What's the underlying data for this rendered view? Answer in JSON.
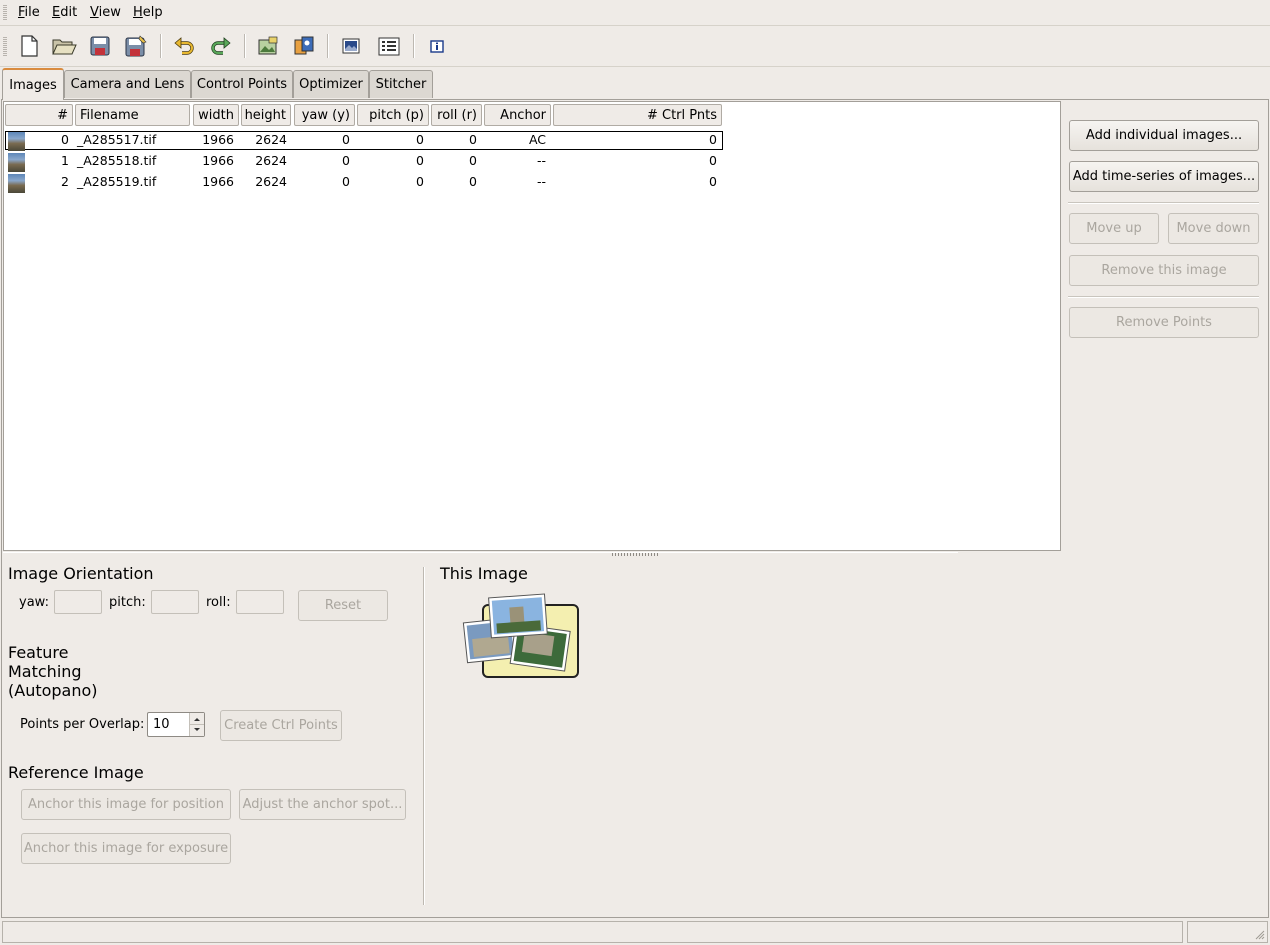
{
  "menu": [
    {
      "label": "File",
      "underline": "F",
      "rest": "ile"
    },
    {
      "label": "Edit",
      "underline": "E",
      "rest": "dit"
    },
    {
      "label": "View",
      "underline": "V",
      "rest": "iew"
    },
    {
      "label": "Help",
      "underline": "H",
      "rest": "elp"
    }
  ],
  "toolbar_icons": [
    "new-file-icon",
    "open-folder-icon",
    "save-icon",
    "save-as-icon",
    "undo-icon",
    "redo-icon",
    "add-images-icon",
    "align-icon",
    "preview-icon",
    "optimizer-list-icon",
    "info-icon"
  ],
  "tabs": [
    "Images",
    "Camera and Lens",
    "Control Points",
    "Optimizer",
    "Stitcher"
  ],
  "columns": [
    "#",
    "Filename",
    "width",
    "height",
    "yaw (y)",
    "pitch (p)",
    "roll (r)",
    "Anchor",
    "# Ctrl Pnts"
  ],
  "rows": [
    {
      "num": "0",
      "filename": "_A285517.tif",
      "width": "1966",
      "height": "2624",
      "yaw": "0",
      "pitch": "0",
      "roll": "0",
      "anchor": "AC",
      "ctrl": "0"
    },
    {
      "num": "1",
      "filename": "_A285518.tif",
      "width": "1966",
      "height": "2624",
      "yaw": "0",
      "pitch": "0",
      "roll": "0",
      "anchor": "--",
      "ctrl": "0"
    },
    {
      "num": "2",
      "filename": "_A285519.tif",
      "width": "1966",
      "height": "2624",
      "yaw": "0",
      "pitch": "0",
      "roll": "0",
      "anchor": "--",
      "ctrl": "0"
    }
  ],
  "side_buttons": {
    "add_individual": "Add individual images...",
    "add_time_series": "Add time-series of images...",
    "move_up": "Move up",
    "move_down": "Move down",
    "remove_image": "Remove this image",
    "remove_points": "Remove Points"
  },
  "orientation": {
    "title": "Image Orientation",
    "yaw_label": "yaw:",
    "pitch_label": "pitch:",
    "roll_label": "roll:",
    "reset": "Reset"
  },
  "feature": {
    "title_line1": "Feature",
    "title_line2": "Matching",
    "title_line3": "(Autopano)",
    "points_label": "Points per Overlap:",
    "points_value": "10",
    "create_button": "Create Ctrl Points"
  },
  "reference": {
    "title": "Reference Image",
    "anchor_position": "Anchor this image for position",
    "adjust_anchor": "Adjust the anchor spot...",
    "anchor_exposure": "Anchor this image for exposure"
  },
  "this_image": {
    "title": "This Image"
  },
  "colors": {
    "window_bg": "#efebe7",
    "active_tab_accent": "#d98b3f",
    "list_bg": "#ffffff",
    "disabled_text": "#aaa69f"
  }
}
